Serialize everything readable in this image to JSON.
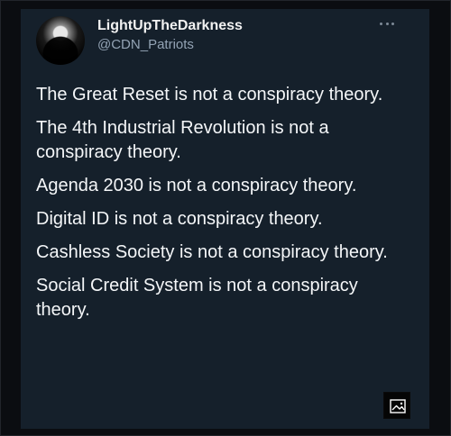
{
  "profile": {
    "display_name": "LightUpTheDarkness",
    "handle": "@CDN_Patriots",
    "avatar_icon": "masked-face-avatar",
    "more_icon": "more-icon"
  },
  "tweet": {
    "lines": [
      "The Great Reset is not a conspiracy theory.",
      "The 4th Industrial Revolution is not a conspiracy theory.",
      "Agenda 2030 is not a conspiracy theory.",
      "Digital ID is not a conspiracy theory.",
      "Cashless Society is not a conspiracy theory.",
      "Social Credit System is not a conspiracy theory."
    ]
  },
  "overlay": {
    "image_icon": "image-icon"
  },
  "colors": {
    "page_background": "#0b0d11",
    "card_background": "#15202b",
    "text_primary": "#f4f6f8",
    "text_secondary": "#93a3b4"
  }
}
